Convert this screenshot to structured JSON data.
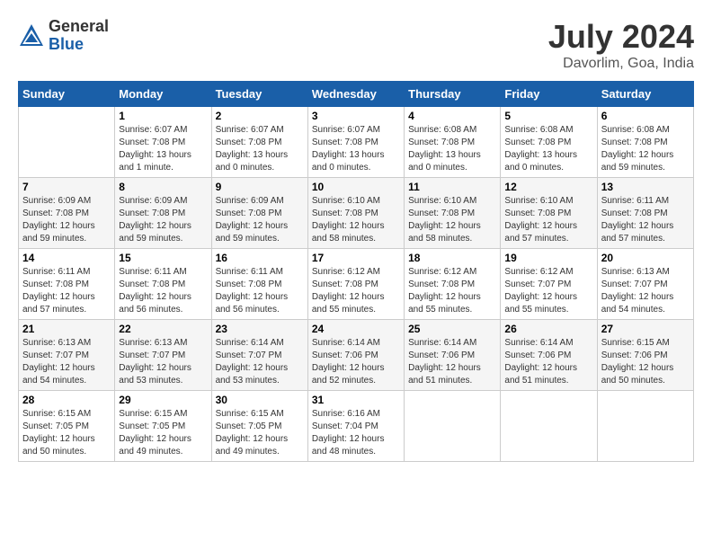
{
  "header": {
    "logo_general": "General",
    "logo_blue": "Blue",
    "month_year": "July 2024",
    "location": "Davorlim, Goa, India"
  },
  "weekdays": [
    "Sunday",
    "Monday",
    "Tuesday",
    "Wednesday",
    "Thursday",
    "Friday",
    "Saturday"
  ],
  "weeks": [
    [
      {
        "day": "",
        "info": ""
      },
      {
        "day": "1",
        "info": "Sunrise: 6:07 AM\nSunset: 7:08 PM\nDaylight: 13 hours\nand 1 minute."
      },
      {
        "day": "2",
        "info": "Sunrise: 6:07 AM\nSunset: 7:08 PM\nDaylight: 13 hours\nand 0 minutes."
      },
      {
        "day": "3",
        "info": "Sunrise: 6:07 AM\nSunset: 7:08 PM\nDaylight: 13 hours\nand 0 minutes."
      },
      {
        "day": "4",
        "info": "Sunrise: 6:08 AM\nSunset: 7:08 PM\nDaylight: 13 hours\nand 0 minutes."
      },
      {
        "day": "5",
        "info": "Sunrise: 6:08 AM\nSunset: 7:08 PM\nDaylight: 13 hours\nand 0 minutes."
      },
      {
        "day": "6",
        "info": "Sunrise: 6:08 AM\nSunset: 7:08 PM\nDaylight: 12 hours\nand 59 minutes."
      }
    ],
    [
      {
        "day": "7",
        "info": "Sunrise: 6:09 AM\nSunset: 7:08 PM\nDaylight: 12 hours\nand 59 minutes."
      },
      {
        "day": "8",
        "info": "Sunrise: 6:09 AM\nSunset: 7:08 PM\nDaylight: 12 hours\nand 59 minutes."
      },
      {
        "day": "9",
        "info": "Sunrise: 6:09 AM\nSunset: 7:08 PM\nDaylight: 12 hours\nand 59 minutes."
      },
      {
        "day": "10",
        "info": "Sunrise: 6:10 AM\nSunset: 7:08 PM\nDaylight: 12 hours\nand 58 minutes."
      },
      {
        "day": "11",
        "info": "Sunrise: 6:10 AM\nSunset: 7:08 PM\nDaylight: 12 hours\nand 58 minutes."
      },
      {
        "day": "12",
        "info": "Sunrise: 6:10 AM\nSunset: 7:08 PM\nDaylight: 12 hours\nand 57 minutes."
      },
      {
        "day": "13",
        "info": "Sunrise: 6:11 AM\nSunset: 7:08 PM\nDaylight: 12 hours\nand 57 minutes."
      }
    ],
    [
      {
        "day": "14",
        "info": "Sunrise: 6:11 AM\nSunset: 7:08 PM\nDaylight: 12 hours\nand 57 minutes."
      },
      {
        "day": "15",
        "info": "Sunrise: 6:11 AM\nSunset: 7:08 PM\nDaylight: 12 hours\nand 56 minutes."
      },
      {
        "day": "16",
        "info": "Sunrise: 6:11 AM\nSunset: 7:08 PM\nDaylight: 12 hours\nand 56 minutes."
      },
      {
        "day": "17",
        "info": "Sunrise: 6:12 AM\nSunset: 7:08 PM\nDaylight: 12 hours\nand 55 minutes."
      },
      {
        "day": "18",
        "info": "Sunrise: 6:12 AM\nSunset: 7:08 PM\nDaylight: 12 hours\nand 55 minutes."
      },
      {
        "day": "19",
        "info": "Sunrise: 6:12 AM\nSunset: 7:07 PM\nDaylight: 12 hours\nand 55 minutes."
      },
      {
        "day": "20",
        "info": "Sunrise: 6:13 AM\nSunset: 7:07 PM\nDaylight: 12 hours\nand 54 minutes."
      }
    ],
    [
      {
        "day": "21",
        "info": "Sunrise: 6:13 AM\nSunset: 7:07 PM\nDaylight: 12 hours\nand 54 minutes."
      },
      {
        "day": "22",
        "info": "Sunrise: 6:13 AM\nSunset: 7:07 PM\nDaylight: 12 hours\nand 53 minutes."
      },
      {
        "day": "23",
        "info": "Sunrise: 6:14 AM\nSunset: 7:07 PM\nDaylight: 12 hours\nand 53 minutes."
      },
      {
        "day": "24",
        "info": "Sunrise: 6:14 AM\nSunset: 7:06 PM\nDaylight: 12 hours\nand 52 minutes."
      },
      {
        "day": "25",
        "info": "Sunrise: 6:14 AM\nSunset: 7:06 PM\nDaylight: 12 hours\nand 51 minutes."
      },
      {
        "day": "26",
        "info": "Sunrise: 6:14 AM\nSunset: 7:06 PM\nDaylight: 12 hours\nand 51 minutes."
      },
      {
        "day": "27",
        "info": "Sunrise: 6:15 AM\nSunset: 7:06 PM\nDaylight: 12 hours\nand 50 minutes."
      }
    ],
    [
      {
        "day": "28",
        "info": "Sunrise: 6:15 AM\nSunset: 7:05 PM\nDaylight: 12 hours\nand 50 minutes."
      },
      {
        "day": "29",
        "info": "Sunrise: 6:15 AM\nSunset: 7:05 PM\nDaylight: 12 hours\nand 49 minutes."
      },
      {
        "day": "30",
        "info": "Sunrise: 6:15 AM\nSunset: 7:05 PM\nDaylight: 12 hours\nand 49 minutes."
      },
      {
        "day": "31",
        "info": "Sunrise: 6:16 AM\nSunset: 7:04 PM\nDaylight: 12 hours\nand 48 minutes."
      },
      {
        "day": "",
        "info": ""
      },
      {
        "day": "",
        "info": ""
      },
      {
        "day": "",
        "info": ""
      }
    ]
  ]
}
